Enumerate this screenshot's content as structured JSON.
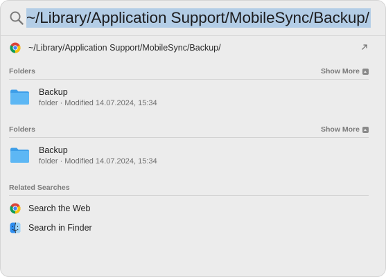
{
  "search": {
    "query": "~/Library/Application Support/MobileSync/Backup/"
  },
  "top_hit": {
    "label": "~/Library/Application Support/MobileSync/Backup/",
    "icon": "chrome-icon"
  },
  "sections": [
    {
      "title": "Folders",
      "show_more": "Show More",
      "items": [
        {
          "name": "Backup",
          "detail": "folder · Modified 14.07.2024, 15:34",
          "icon": "folder-icon"
        }
      ]
    },
    {
      "title": "Folders",
      "show_more": "Show More",
      "items": [
        {
          "name": "Backup",
          "detail": "folder · Modified 14.07.2024, 15:34",
          "icon": "folder-icon"
        }
      ]
    }
  ],
  "related": {
    "title": "Related Searches",
    "items": [
      {
        "label": "Search the Web",
        "icon": "chrome-icon"
      },
      {
        "label": "Search in Finder",
        "icon": "finder-icon"
      }
    ]
  },
  "colors": {
    "panel_bg": "#ececec",
    "selection": "#b3cde6",
    "folder_blue": "#4eaef0",
    "section_text": "#7a7a7a"
  }
}
